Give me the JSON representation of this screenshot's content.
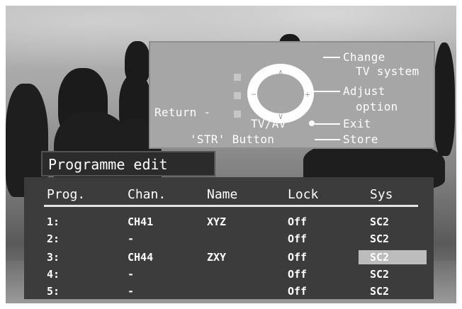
{
  "help": {
    "change": "Change",
    "tv_system": "TV system",
    "adjust": "Adjust",
    "option": "option",
    "return": "Return -",
    "tvav": "TV/AV",
    "exit": "Exit",
    "str_button": "'STR' Button",
    "store": "Store"
  },
  "menu": {
    "title": "Programme edit",
    "columns": [
      "Prog.",
      "Chan.",
      "Name",
      "Lock",
      "Sys"
    ],
    "rows": [
      {
        "prog": "1:",
        "chan": "CH41",
        "name": "XYZ",
        "lock": "Off",
        "sys": "SC2"
      },
      {
        "prog": "2:",
        "chan": "-",
        "name": "",
        "lock": "Off",
        "sys": "SC2"
      },
      {
        "prog": "3:",
        "chan": "CH44",
        "name": "ZXY",
        "lock": "Off",
        "sys": "SC2"
      },
      {
        "prog": "4:",
        "chan": "-",
        "name": "",
        "lock": "Off",
        "sys": "SC2"
      },
      {
        "prog": "5:",
        "chan": "-",
        "name": "",
        "lock": "Off",
        "sys": "SC2"
      }
    ]
  },
  "colors": {
    "panel": "#3c3c3c",
    "help_panel": "#a6a6a6",
    "highlight": "#bcbcbc",
    "text": "#ffffff"
  }
}
